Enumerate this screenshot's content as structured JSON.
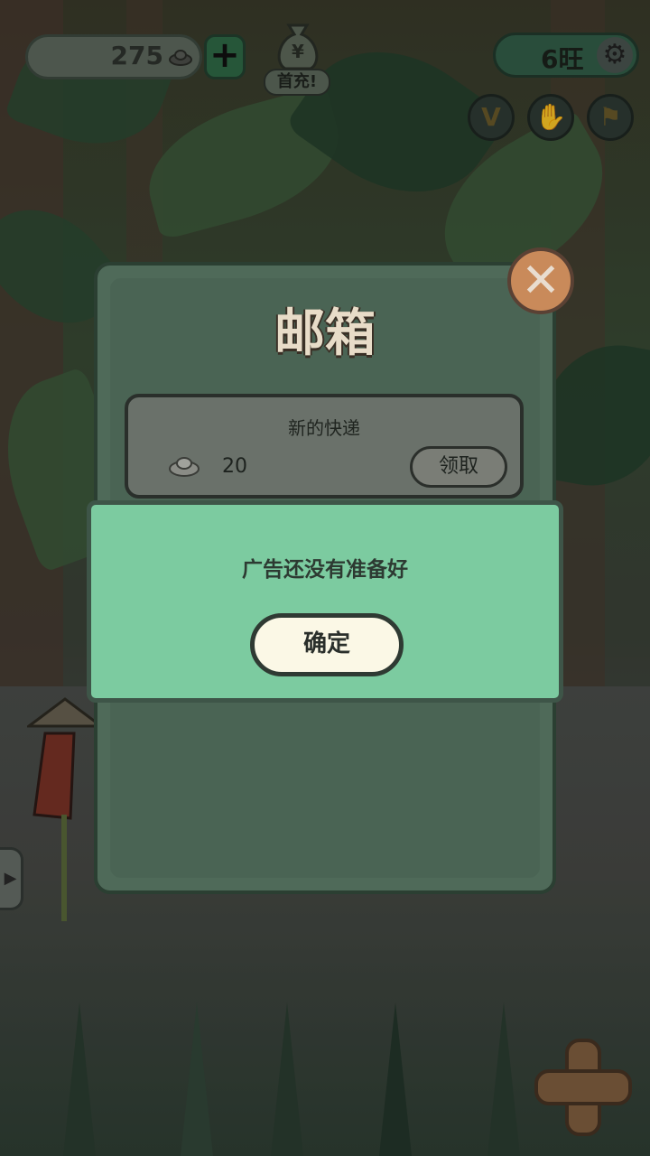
{
  "hud": {
    "coins": "275",
    "first_charge": "首充!",
    "bag_symbol": "¥",
    "wang": "6旺"
  },
  "mailbox": {
    "title": "邮箱",
    "items": [
      {
        "subject": "新的快递",
        "amount": "20",
        "claim_label": "领取"
      }
    ]
  },
  "alert": {
    "message": "广告还没有准备好",
    "confirm_label": "确定"
  },
  "icons": {
    "round_buttons": [
      "v-icon",
      "hand-icon",
      "flag-icon"
    ]
  },
  "colors": {
    "dialog_green": "#7ccba0",
    "panel_green": "#4f6a59",
    "close_orange": "#c98a5a",
    "button_cream": "#fbf8e6"
  }
}
